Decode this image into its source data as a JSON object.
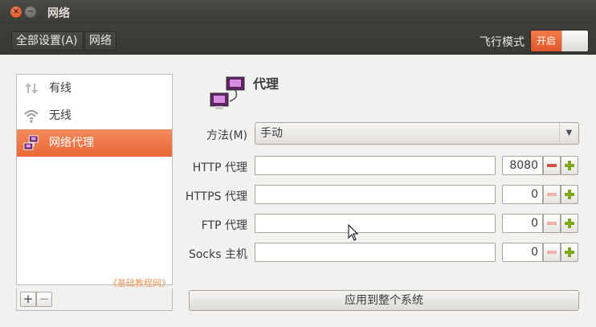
{
  "window": {
    "title": "网络",
    "close_icon": "×",
    "min_icon": "−"
  },
  "toolbar": {
    "breadcrumbs": [
      {
        "label": "全部设置(A)"
      },
      {
        "label": "网络"
      }
    ],
    "airplane_mode_label": "飞行模式",
    "airplane_switch_text": "开启",
    "airplane_mode_on": true
  },
  "devices": [
    {
      "label": "有线",
      "icon": "wired-icon"
    },
    {
      "label": "无线",
      "icon": "wifi-icon"
    },
    {
      "label": "网络代理",
      "icon": "proxy-icon",
      "selected": true
    }
  ],
  "list_actions": {
    "add_label": "+",
    "remove_label": "−"
  },
  "watermark": "《基础教程网》",
  "proxy": {
    "title": "代理",
    "method_label": "方法(M)",
    "method_value": "手动",
    "rows": [
      {
        "label": "HTTP 代理",
        "host": "",
        "port": "8080"
      },
      {
        "label": "HTTPS 代理",
        "host": "",
        "port": "0"
      },
      {
        "label": "FTP 代理",
        "host": "",
        "port": "0"
      },
      {
        "label": "Socks 主机",
        "host": "",
        "port": "0"
      }
    ],
    "apply_label": "应用到整个系统"
  },
  "colors": {
    "accent": "#e86835",
    "plus_green": "#7da81c",
    "minus_red": "#d6504a"
  }
}
